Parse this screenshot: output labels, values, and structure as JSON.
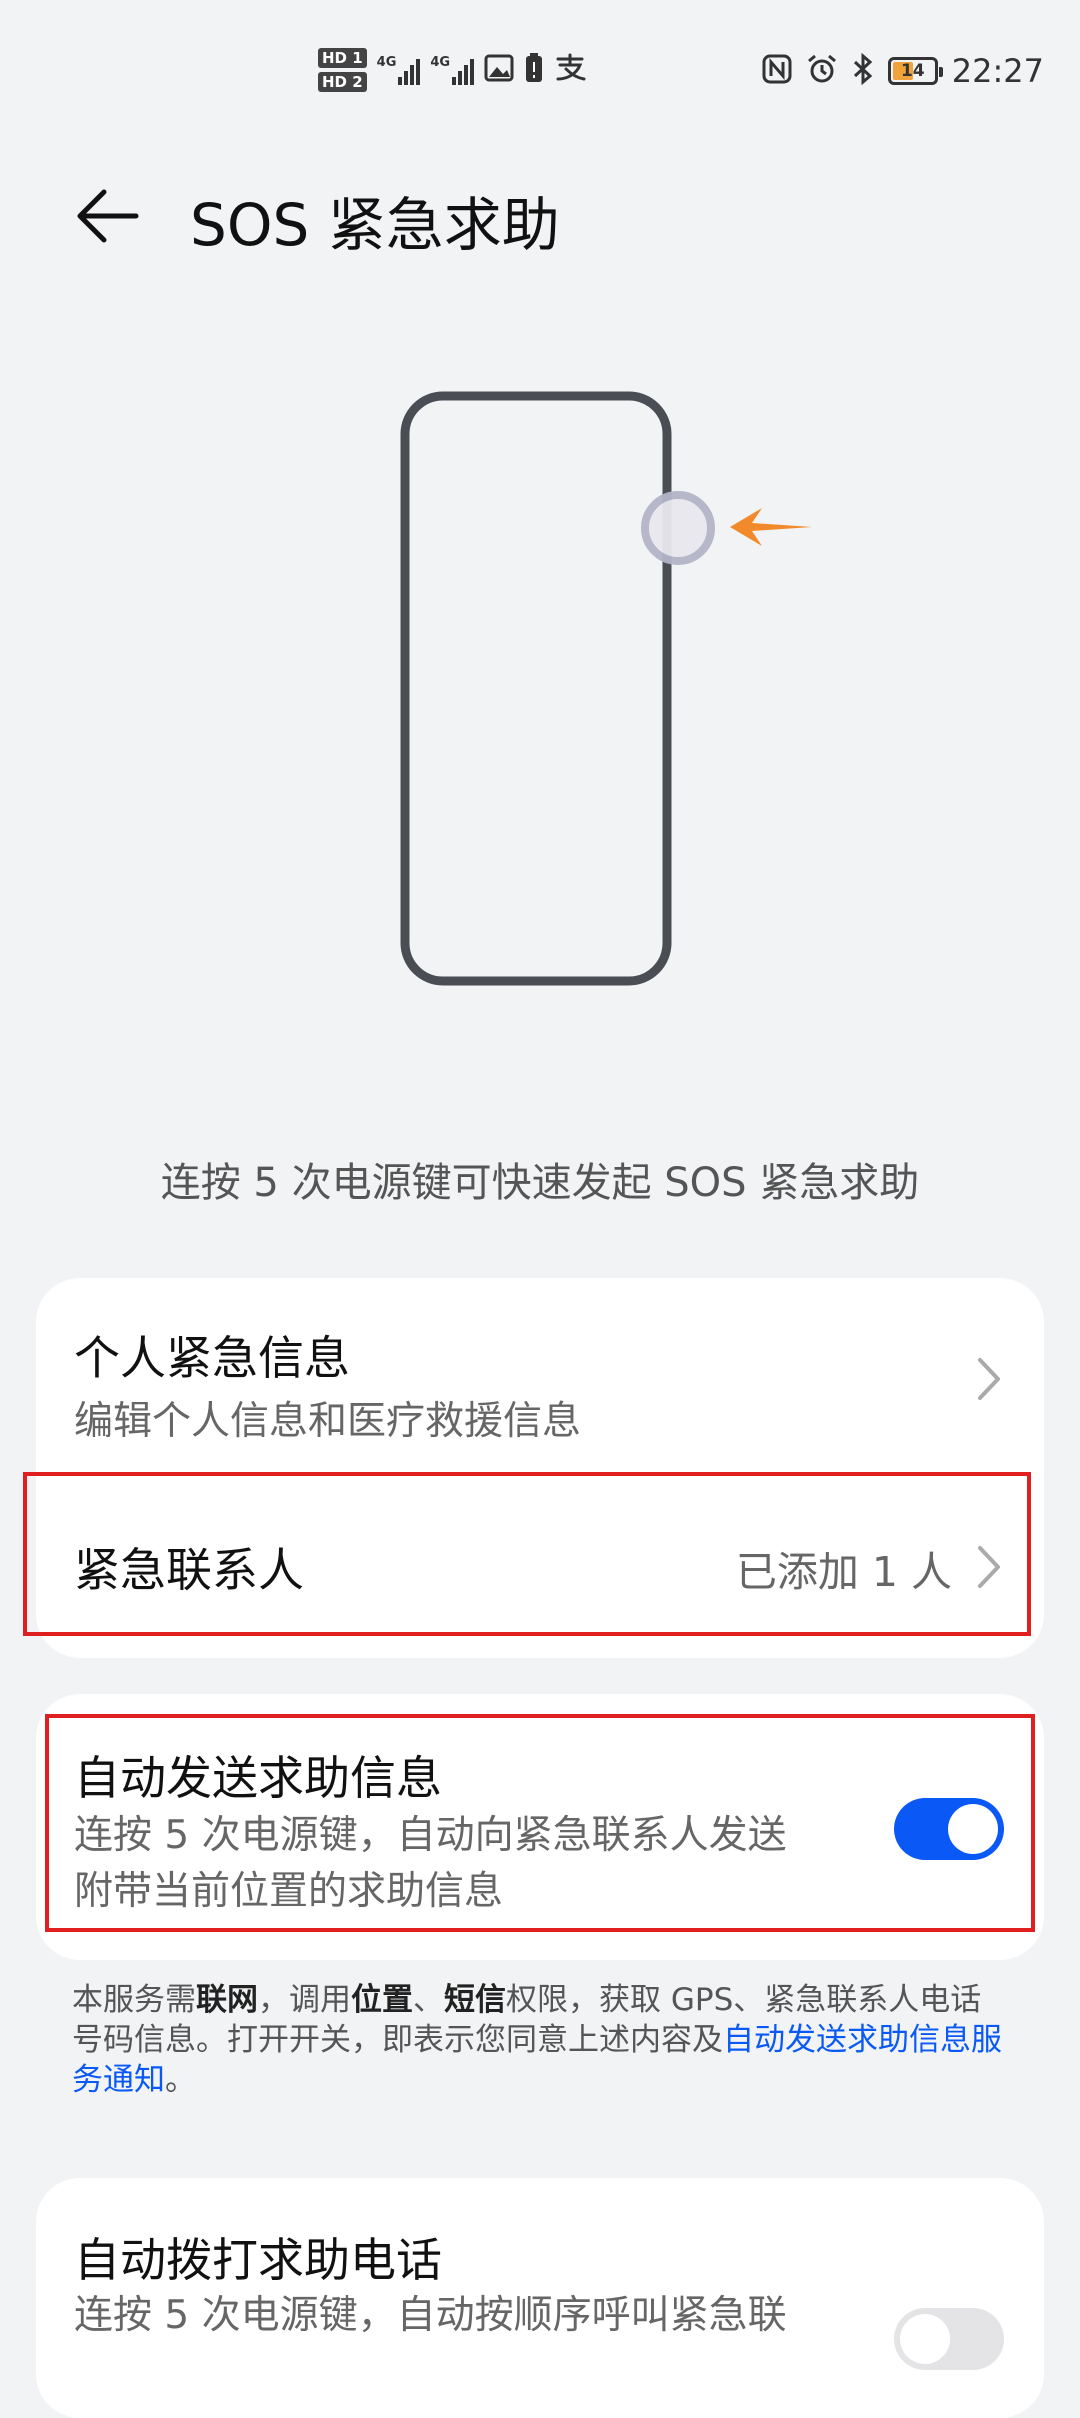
{
  "status_bar": {
    "sim1": "HD 1",
    "sim2": "HD 2",
    "net1": "4G",
    "net2": "4G",
    "time": "22:27",
    "battery_level": "14",
    "battery_color": "#f0a33a",
    "icons": [
      "signal-icon",
      "gallery-icon",
      "battery-saver-icon",
      "alipay-icon",
      "nfc-icon",
      "alarm-icon",
      "bluetooth-icon"
    ]
  },
  "header": {
    "title": "SOS 紧急求助"
  },
  "illustration": {
    "accent_color": "#f28a2c",
    "frame_color": "#4b4d55"
  },
  "hint": "连按 5 次电源键可快速发起 SOS 紧急求助",
  "card1": {
    "personal": {
      "title": "个人紧急信息",
      "subtitle": "编辑个人信息和医疗救援信息"
    },
    "contacts": {
      "title": "紧急联系人",
      "value": "已添加 1 人"
    }
  },
  "card2": {
    "title": "自动发送求助信息",
    "subtitle_line1": "连按 5 次电源键，自动向紧急联系人发送",
    "subtitle_line2": "附带当前位置的求助信息",
    "toggle_on": true,
    "toggle_color": "#0a59f7"
  },
  "notice": {
    "p1": "本服务需",
    "b1": "联网",
    "p2": "，调用",
    "b2": "位置",
    "p3": "、",
    "b3": "短信",
    "p4": "权限，获取 GPS、紧急联系人电话号码信息。打开开关，即表示您同意上述内容及",
    "link": "自动发送求助信息服务通知",
    "p5": "。"
  },
  "card3": {
    "title": "自动拨打求助电话",
    "subtitle": "连按 5 次电源键，自动按顺序呼叫紧急联",
    "toggle_on": false
  },
  "highlight_color": "#e02020"
}
